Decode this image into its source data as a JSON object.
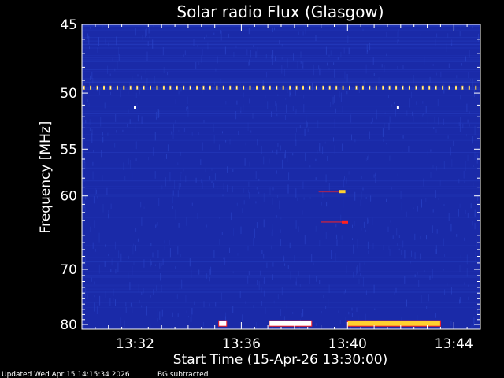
{
  "chart_data": {
    "type": "heatmap",
    "title": "Solar radio Flux (Glasgow)",
    "xlabel": "Start Time (15-Apr-26 13:30:00)",
    "ylabel": "Frequency [MHz]",
    "x_unit": "minutes after 13:30:00",
    "xlim": [
      0,
      15
    ],
    "ylim_inverted": [
      45,
      81
    ],
    "x_tick_values": [
      2,
      6,
      10,
      14
    ],
    "x_tick_labels": [
      "13:32",
      "13:36",
      "13:40",
      "13:44"
    ],
    "y_ticks": [
      45,
      50,
      55,
      60,
      70,
      80
    ],
    "y_tick_labels": [
      "45",
      "50",
      "55",
      "60",
      "70",
      "80"
    ],
    "colors": {
      "background": "#000000",
      "field": "#1a2aa8",
      "noise": "#2a44c8",
      "hot": "#ff2020",
      "warm": "#ffd030",
      "peak": "#ffffff"
    },
    "features": {
      "periodic_interference": {
        "freq_mhz": 49.6,
        "period_min": 0.25
      },
      "isolated_points": [
        {
          "t": 2.0,
          "f": 51.2
        },
        {
          "t": 11.9,
          "f": 51.2
        }
      ],
      "bursts": [
        {
          "t": 9.8,
          "f": 59.5,
          "intensity": "warm"
        },
        {
          "t": 9.9,
          "f": 63.2,
          "intensity": "hot"
        }
      ],
      "bottom_bands": [
        {
          "t_start": 5.15,
          "t_end": 5.45,
          "f": 79.8,
          "color": "peak"
        },
        {
          "t_start": 7.05,
          "t_end": 8.65,
          "f": 79.8,
          "color": "peak"
        },
        {
          "t_start": 10.0,
          "t_end": 13.5,
          "f": 79.8,
          "color": "warm"
        }
      ]
    }
  },
  "footer": {
    "updated": "Updated Wed Apr 15 14:15:34 2026",
    "note": "BG subtracted"
  }
}
